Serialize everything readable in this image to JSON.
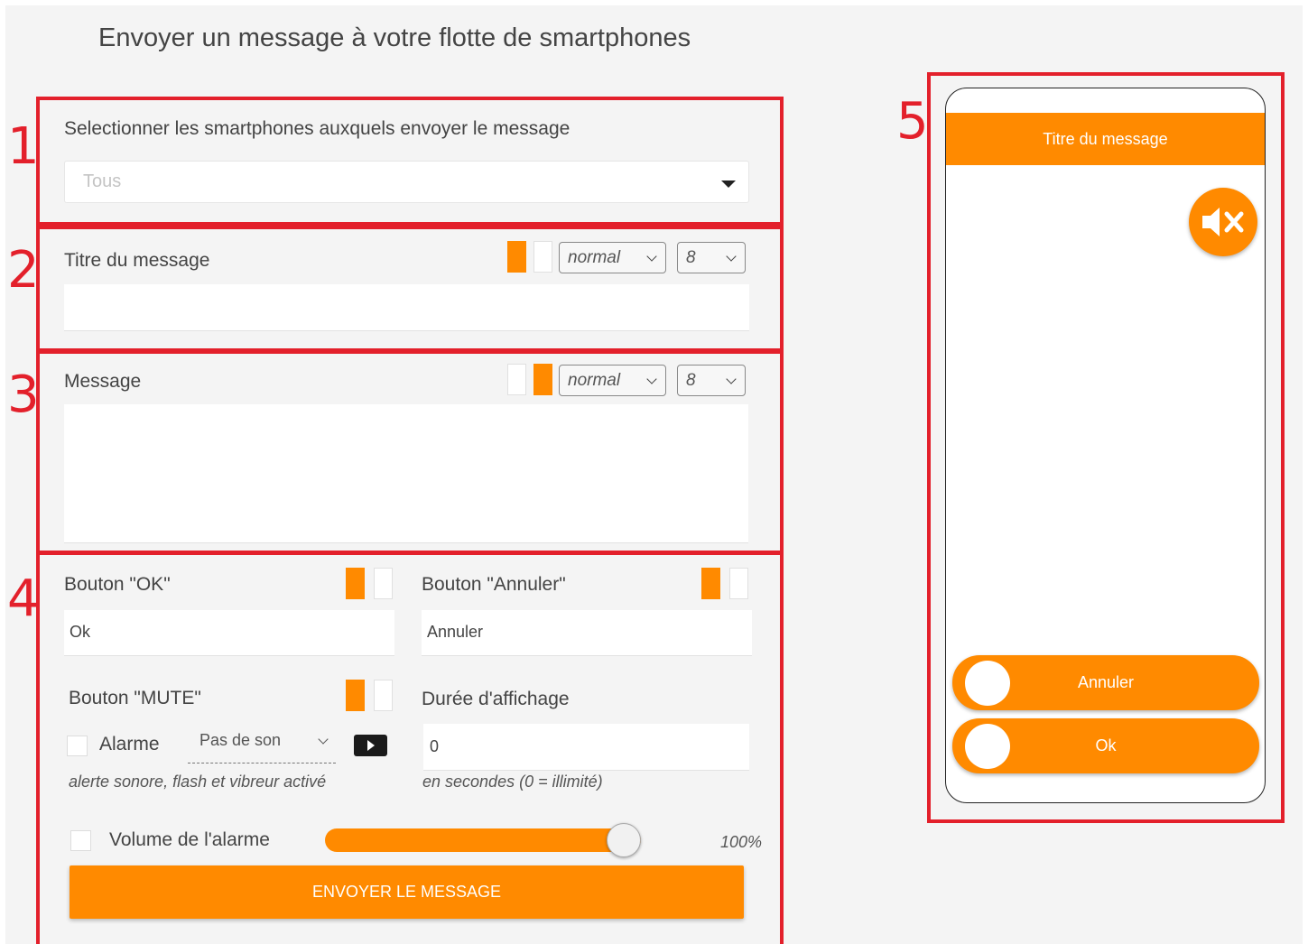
{
  "page": {
    "title": "Envoyer un message à votre flotte de smartphones"
  },
  "markers": [
    "1",
    "2",
    "3",
    "4",
    "5"
  ],
  "section1": {
    "label": "Selectionner les smartphones auxquels envoyer le message",
    "select_placeholder": "Tous"
  },
  "section2": {
    "label": "Titre du message",
    "style_value": "normal",
    "size_value": "8",
    "input_value": ""
  },
  "section3": {
    "label": "Message",
    "style_value": "normal",
    "size_value": "8",
    "input_value": ""
  },
  "section4": {
    "ok_label": "Bouton \"OK\"",
    "ok_value": "Ok",
    "cancel_label": "Bouton \"Annuler\"",
    "cancel_value": "Annuler",
    "mute_label": "Bouton \"MUTE\"",
    "duration_label": "Durée d'affichage",
    "alarm_label": "Alarme",
    "sound_value": "Pas de son",
    "duration_value": "0",
    "alarm_hint": "alerte sonore, flash et vibreur activé",
    "duration_hint": "en secondes (0 = illimité)",
    "volume_label": "Volume de l'alarme",
    "volume_percent": 100,
    "volume_text": "100%",
    "send_label": "ENVOYER LE MESSAGE"
  },
  "preview": {
    "header_title": "Titre du message",
    "cancel_label": "Annuler",
    "ok_label": "Ok",
    "mute_icon": "speaker-mute-icon"
  },
  "colors": {
    "accent": "#ff8a00",
    "annotation": "#e3202b"
  }
}
